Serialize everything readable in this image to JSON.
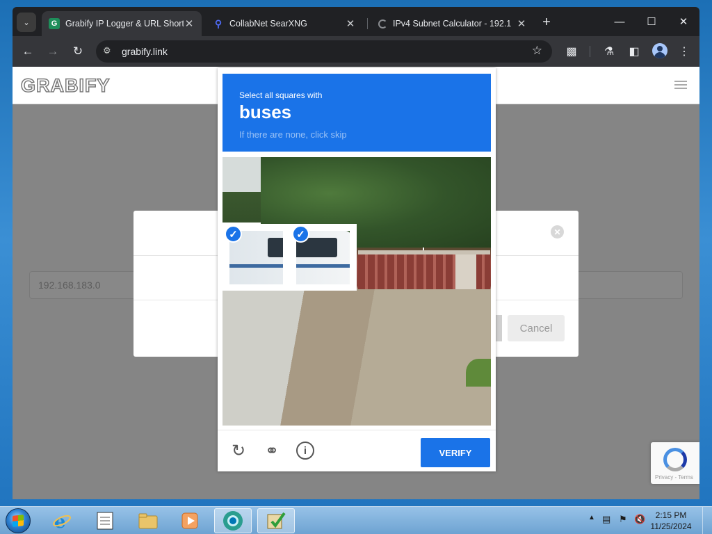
{
  "browser": {
    "tabs": [
      {
        "title": "Grabify IP Logger & URL Short",
        "favicon": "G",
        "active": true
      },
      {
        "title": "CollabNet SearXNG",
        "favicon": "search-icon",
        "active": false
      },
      {
        "title": "IPv4 Subnet Calculator - 192.1",
        "favicon": "loading-icon",
        "active": false
      }
    ],
    "url": "grabify.link"
  },
  "page": {
    "logo": "GRABIFY",
    "ip_value": "192.168.183.0",
    "modal": {
      "cancel_label": "Cancel",
      "close_glyph": "✕"
    },
    "recaptcha_footer": "Privacy - Terms"
  },
  "captcha": {
    "line1": "Select all squares with",
    "target": "buses",
    "line3": "If there are none, click skip",
    "verify_label": "VERIFY",
    "grid_rows": 4,
    "grid_cols": 4,
    "selected_tiles": [
      4,
      5
    ]
  },
  "taskbar": {
    "time": "2:15 PM",
    "date": "11/25/2024"
  },
  "colors": {
    "accent": "#1a73e8",
    "chrome_dark": "#202124",
    "chrome_toolbar": "#35363a"
  }
}
